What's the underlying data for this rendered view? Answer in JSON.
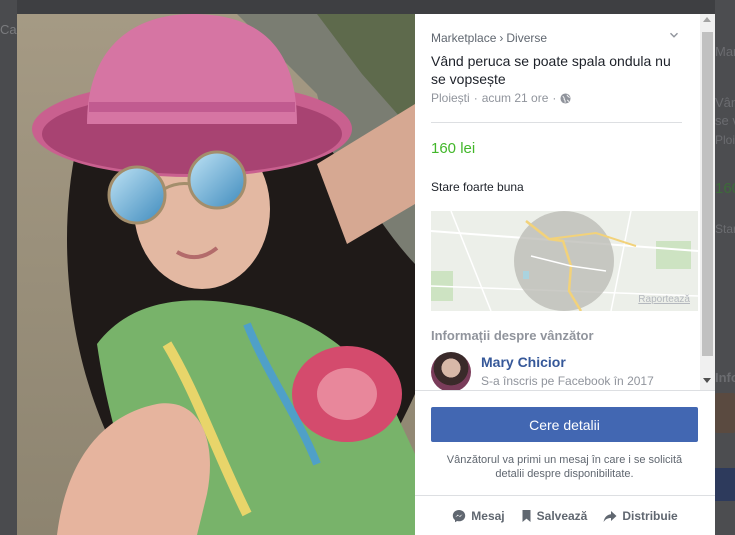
{
  "background": {
    "left_partial_text": "Ca",
    "right_partial_lines": [
      "Mar",
      "Vân",
      "se v",
      "Ploi",
      "160",
      "Star",
      "Info"
    ]
  },
  "breadcrumb": {
    "items": [
      "Marketplace",
      "Diverse"
    ],
    "separator": "›"
  },
  "listing": {
    "title": "Vând peruca se poate spala ondula nu se vopsește",
    "location": "Ploiești",
    "time": "acum 21 ore",
    "meta_separator": "·",
    "privacy_icon": "globe-icon",
    "price": "160 lei",
    "condition": "Stare foarte buna"
  },
  "map": {
    "report_link": "Raportează"
  },
  "seller": {
    "heading": "Informații despre vânzător",
    "name": "Mary Chicior",
    "since": "S-a înscris pe Facebook în 2017"
  },
  "cta": {
    "label": "Cere detalii",
    "note": "Vânzătorul va primi un mesaj în care i se solicită detalii despre disponibilitate."
  },
  "actions": [
    {
      "label": "Mesaj",
      "icon": "messenger-icon"
    },
    {
      "label": "Salvează",
      "icon": "bookmark-icon"
    },
    {
      "label": "Distribuie",
      "icon": "share-icon"
    }
  ],
  "colors": {
    "price": "#42b72a",
    "link": "#365899",
    "button": "#4267b2",
    "overlay": "#3e3f42"
  }
}
